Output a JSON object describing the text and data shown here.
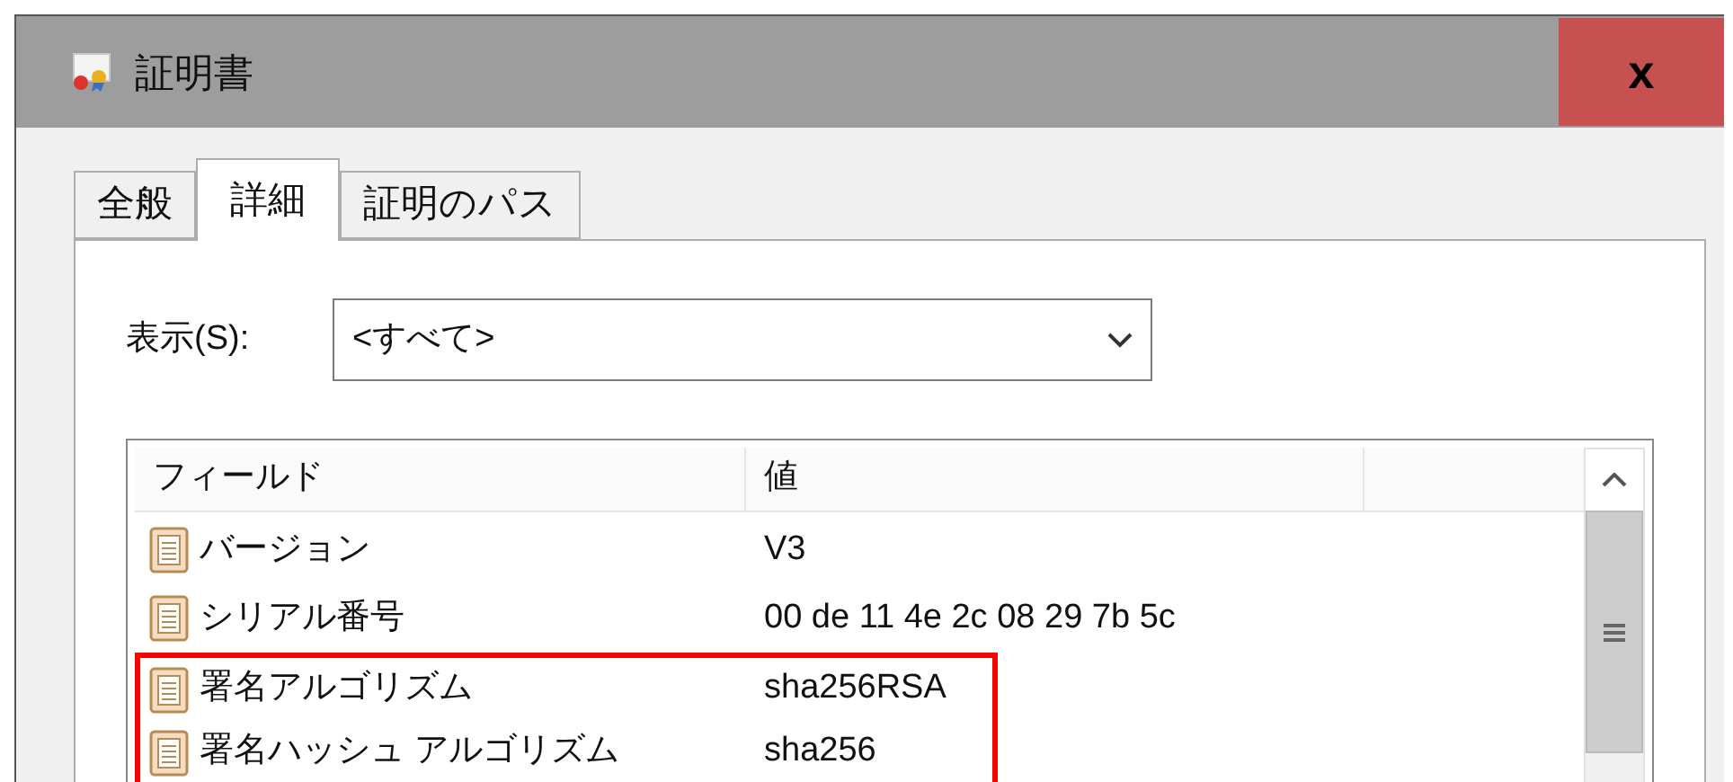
{
  "window": {
    "title": "証明書",
    "close": "x"
  },
  "tabs": [
    {
      "label": "全般",
      "selected": false
    },
    {
      "label": "詳細",
      "selected": true
    },
    {
      "label": "証明のパス",
      "selected": false
    }
  ],
  "show": {
    "label": "表示(S):",
    "value": "<すべて>"
  },
  "table": {
    "columns": [
      "フィールド",
      "値"
    ],
    "rows": [
      {
        "field": "バージョン",
        "value": "V3",
        "highlighted": false
      },
      {
        "field": "シリアル番号",
        "value": "00 de 11 4e 2c 08 29 7b 5c",
        "highlighted": false
      },
      {
        "field": "署名アルゴリズム",
        "value": "sha256RSA",
        "highlighted": true
      },
      {
        "field": "署名ハッシュ アルゴリズム",
        "value": "sha256",
        "highlighted": true
      }
    ]
  }
}
